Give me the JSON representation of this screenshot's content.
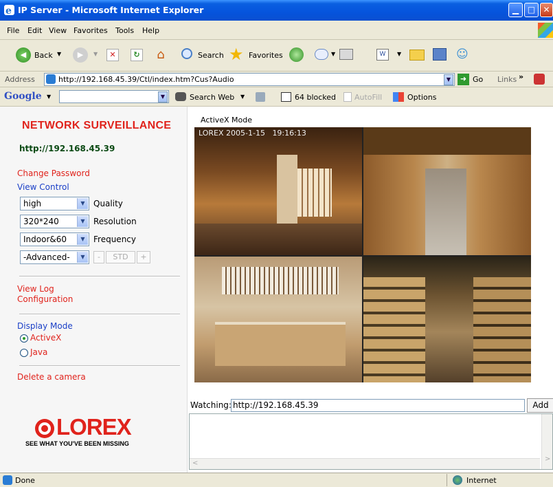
{
  "window": {
    "title": "IP Server - Microsoft Internet Explorer",
    "min": "▁",
    "max": "□",
    "close": "✕"
  },
  "menu": [
    "File",
    "Edit",
    "View",
    "Favorites",
    "Tools",
    "Help"
  ],
  "toolbar": {
    "back": "Back",
    "search": "Search",
    "favorites": "Favorites"
  },
  "address": {
    "label": "Address",
    "url": "http://192.168.45.39/Ctl/index.htm?Cus?Audio",
    "go": "Go",
    "links": "Links"
  },
  "google": {
    "logo": "Google",
    "search_web": "Search Web",
    "blocked": "64 blocked",
    "autofill": "AutoFill",
    "options": "Options"
  },
  "panel": {
    "brand": "NETWORK SURVEILLANCE",
    "host": "http://192.168.45.39",
    "change_password": "Change Password",
    "view_control": "View Control",
    "quality": {
      "value": "high",
      "label": "Quality"
    },
    "resolution": {
      "value": "320*240",
      "label": "Resolution"
    },
    "frequency": {
      "value": "Indoor&60",
      "label": "Frequency"
    },
    "advanced": {
      "value": "-Advanced-",
      "minus": "-",
      "std": "STD",
      "plus": "+"
    },
    "view_log": "View Log",
    "configuration": "Configuration",
    "display_mode": "Display Mode",
    "activex": "ActiveX",
    "java": "Java",
    "delete_camera": "Delete a camera",
    "logo_text": "LOREX",
    "tagline": "SEE WHAT YOU'VE BEEN MISSING"
  },
  "video": {
    "mode_label": "ActiveX Mode",
    "overlay": "LOREX 2005-1-15   19:16:13",
    "watching_label": "Watching:",
    "watching_value": "http://192.168.45.39",
    "add": "Add"
  },
  "status": {
    "done": "Done",
    "zone": "Internet"
  }
}
